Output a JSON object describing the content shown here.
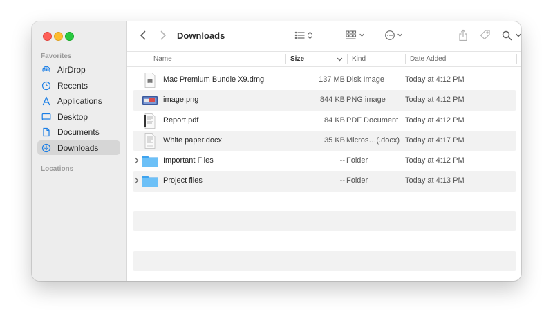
{
  "sidebar": {
    "favorites_label": "Favorites",
    "locations_label": "Locations",
    "items": [
      {
        "label": "AirDrop",
        "icon": "airdrop-icon"
      },
      {
        "label": "Recents",
        "icon": "clock-icon"
      },
      {
        "label": "Applications",
        "icon": "applications-icon"
      },
      {
        "label": "Desktop",
        "icon": "desktop-icon"
      },
      {
        "label": "Documents",
        "icon": "document-icon"
      },
      {
        "label": "Downloads",
        "icon": "download-icon",
        "selected": true
      }
    ]
  },
  "toolbar": {
    "title": "Downloads"
  },
  "columns": {
    "name": "Name",
    "size": "Size",
    "kind": "Kind",
    "date": "Date Added"
  },
  "files": [
    {
      "name": "Mac Premium Bundle X9.dmg",
      "size": "137 MB",
      "kind": "Disk Image",
      "date": "Today at 4:12 PM",
      "icon": "disk-image-icon"
    },
    {
      "name": "image.png",
      "size": "844 KB",
      "kind": "PNG image",
      "date": "Today at 4:12 PM",
      "icon": "image-icon"
    },
    {
      "name": "Report.pdf",
      "size": "84 KB",
      "kind": "PDF Document",
      "date": "Today at 4:12 PM",
      "icon": "pdf-icon"
    },
    {
      "name": "White paper.docx",
      "size": "35 KB",
      "kind": "Micros…(.docx)",
      "date": "Today at 4:17 PM",
      "icon": "docx-icon"
    },
    {
      "name": "Important Files",
      "size": "--",
      "kind": "Folder",
      "date": "Today at 4:12 PM",
      "icon": "folder-icon"
    },
    {
      "name": "Project files",
      "size": "--",
      "kind": "Folder",
      "date": "Today at 4:13 PM",
      "icon": "folder-icon"
    }
  ]
}
